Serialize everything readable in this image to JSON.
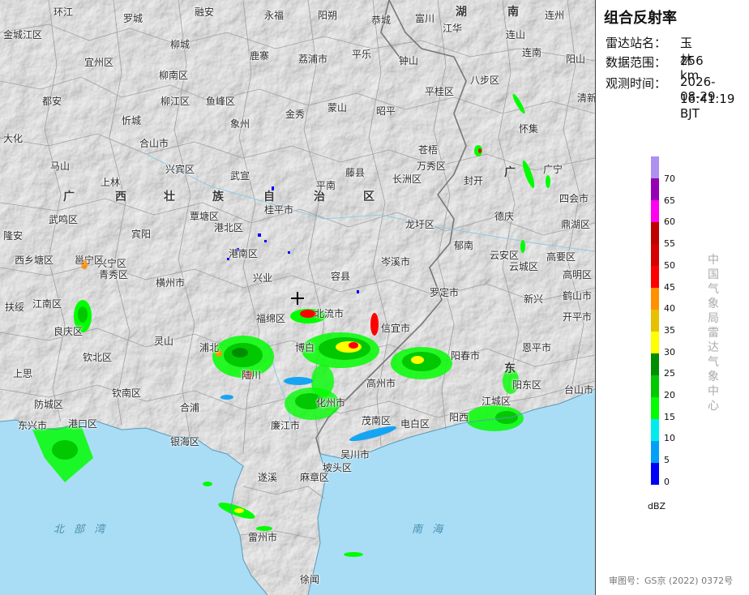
{
  "panel": {
    "title": "组合反射率",
    "station_label": "雷达站名：",
    "station_value": "玉林",
    "range_label": "数据范围：",
    "range_value": "256 km",
    "time_label": "观测时间：",
    "time_date": "2026-08-29",
    "time_clock": "16:41:19 BJT",
    "vertical_caption": "中国气象局雷达气象中心",
    "approval": "审图号：GS京 (2022) 0372号"
  },
  "legend": {
    "unit": "dBZ",
    "ticks": [
      "70",
      "65",
      "60",
      "55",
      "50",
      "45",
      "40",
      "35",
      "30",
      "25",
      "20",
      "15",
      "10",
      "5",
      "0"
    ],
    "colors": [
      "#ad90f0",
      "#9600b4",
      "#ff00f0",
      "#c00000",
      "#d60000",
      "#ff0000",
      "#ff9000",
      "#e7c000",
      "#ffff00",
      "#008e00",
      "#01c801",
      "#02fd02",
      "#00ecec",
      "#01a0f6",
      "#0000f6"
    ]
  },
  "map": {
    "province_labels": [
      "广",
      "西",
      "壮",
      "族",
      "自",
      "治",
      "区",
      "湖",
      "南",
      "广",
      "东"
    ],
    "sea_label": "北 部 湾",
    "sea_label2": "南 海",
    "places": [
      "环江",
      "罗城",
      "融安",
      "永福",
      "阳朔",
      "恭城",
      "富川",
      "江华",
      "连州",
      "连山",
      "金城江区",
      "柳城",
      "鹿寨",
      "荔浦市",
      "平乐",
      "钟山",
      "连南",
      "阳山",
      "宜州区",
      "柳南区",
      "蒙山",
      "昭平",
      "平桂区",
      "八步区",
      "都安",
      "柳江区",
      "鱼峰区",
      "金秀",
      "清新",
      "忻城",
      "象州",
      "苍梧",
      "怀集",
      "大化",
      "合山市",
      "兴宾区",
      "万秀区",
      "封开",
      "广宁",
      "马山",
      "上林",
      "武宣",
      "平南",
      "藤县",
      "长洲区",
      "四会市",
      "武鸣区",
      "宾阳",
      "覃塘区",
      "港北区",
      "桂平市",
      "龙圩区",
      "德庆",
      "鼎湖区",
      "隆安",
      "兴宁区",
      "青秀区",
      "横州市",
      "港南区",
      "兴业",
      "岑溪市",
      "郁南",
      "云安区",
      "云城区",
      "高要区",
      "高明区",
      "西乡塘区",
      "邕宁区",
      "容县",
      "罗定市",
      "新兴",
      "鹤山市",
      "扶绥",
      "江南区",
      "福绵区",
      "北流市",
      "开平市",
      "良庆区",
      "灵山",
      "浦北",
      "信宜市",
      "阳春市",
      "恩平市",
      "上思",
      "钦北区",
      "博白",
      "高州市",
      "阳东区",
      "台山市",
      "钦南区",
      "合浦",
      "陆川",
      "化州市",
      "江城区",
      "防城区",
      "港口区",
      "银海区",
      "廉江市",
      "茂南区",
      "电白区",
      "阳西",
      "东兴市",
      "吴川市",
      "遂溪",
      "麻章区",
      "坡头区",
      "雷州市",
      "徐闻"
    ]
  },
  "station_marker": "+"
}
